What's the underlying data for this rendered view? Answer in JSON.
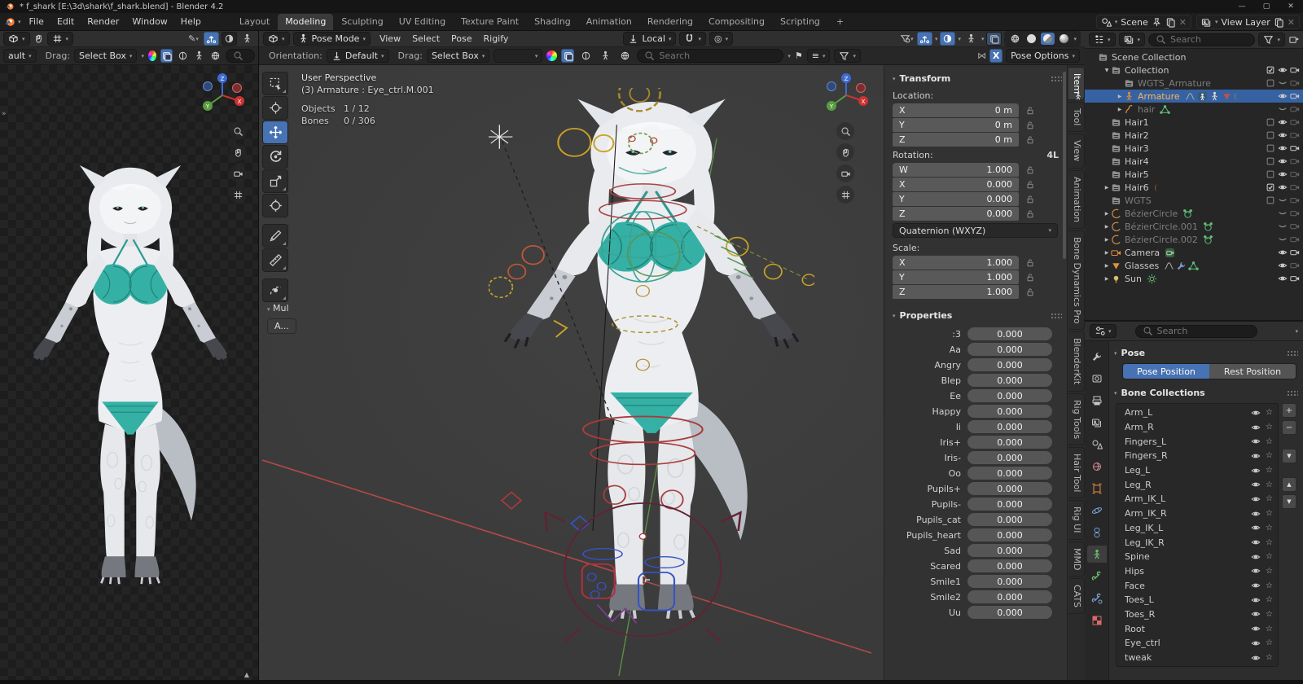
{
  "titlebar": {
    "title": "* f_shark [E:\\3d\\shark\\f_shark.blend] - Blender 4.2",
    "window_buttons": [
      "minimize",
      "maximize",
      "close"
    ]
  },
  "topbar": {
    "menus": [
      "File",
      "Edit",
      "Render",
      "Window",
      "Help"
    ],
    "tabs": [
      "Layout",
      "Modeling",
      "Sculpting",
      "UV Editing",
      "Texture Paint",
      "Shading",
      "Animation",
      "Rendering",
      "Compositing",
      "Scripting"
    ],
    "active_tab": "Modeling",
    "add_tab": "+",
    "scene": {
      "label": "Scene"
    },
    "view_layer": {
      "label": "View Layer"
    }
  },
  "vp_header": {
    "mode": "Pose Mode",
    "menus": [
      "View",
      "Select",
      "Pose",
      "Rigify"
    ],
    "orientation": "Local",
    "shading_modes": [
      "wireframe",
      "solid",
      "material-preview",
      "rendered"
    ],
    "active_shading": "material-preview"
  },
  "tool_settings": {
    "left": {
      "clipped_dropdown": "ault",
      "drag_label": "Drag:",
      "drag_value": "Select Box",
      "search_placeholder": "Searc"
    },
    "main": {
      "orientation_label": "Orientation:",
      "orientation_value": "Default",
      "drag_label": "Drag:",
      "drag_value": "Select Box",
      "search_placeholder": "Search",
      "mirror_x_label": "X",
      "pose_options_label": "Pose Options"
    }
  },
  "viewport": {
    "info_line1": "User Perspective",
    "info_line2": "(3) Armature : Eye_ctrl.M.001",
    "stats": [
      {
        "label": "Objects",
        "value": "1 / 12"
      },
      {
        "label": "Bones",
        "value": "0 / 306"
      }
    ],
    "collapsed_panel_label": "Mul",
    "collapsed_button_label": "A...",
    "toolbar": [
      "select-box-tool",
      "cursor-tool",
      "move-tool",
      "rotate-tool",
      "scale-tool",
      "transform-tool",
      "annotate-tool",
      "measure-tool",
      "pose-breakdowner-tool"
    ],
    "active_tool": "move-tool",
    "nav_buttons": [
      "zoom",
      "pan",
      "camera-view",
      "grid-ortho"
    ]
  },
  "npanel": {
    "transform_title": "Transform",
    "location_label": "Location:",
    "location": [
      {
        "axis": "X",
        "value": "0 m"
      },
      {
        "axis": "Y",
        "value": "0 m"
      },
      {
        "axis": "Z",
        "value": "0 m"
      }
    ],
    "rotation_label": "Rotation:",
    "rotation_badge": "4L",
    "rotation": [
      {
        "axis": "W",
        "value": "1.000"
      },
      {
        "axis": "X",
        "value": "0.000"
      },
      {
        "axis": "Y",
        "value": "0.000"
      },
      {
        "axis": "Z",
        "value": "0.000"
      }
    ],
    "rotation_mode": "Quaternion (WXYZ)",
    "scale_label": "Scale:",
    "scale": [
      {
        "axis": "X",
        "value": "1.000"
      },
      {
        "axis": "Y",
        "value": "1.000"
      },
      {
        "axis": "Z",
        "value": "1.000"
      }
    ],
    "properties_title": "Properties",
    "shape_keys": [
      {
        "name": ":3",
        "value": "0.000"
      },
      {
        "name": "Aa",
        "value": "0.000"
      },
      {
        "name": "Angry",
        "value": "0.000"
      },
      {
        "name": "Blep",
        "value": "0.000"
      },
      {
        "name": "Ee",
        "value": "0.000"
      },
      {
        "name": "Happy",
        "value": "0.000"
      },
      {
        "name": "Ii",
        "value": "0.000"
      },
      {
        "name": "Iris+",
        "value": "0.000"
      },
      {
        "name": "Iris-",
        "value": "0.000"
      },
      {
        "name": "Oo",
        "value": "0.000"
      },
      {
        "name": "Pupils+",
        "value": "0.000"
      },
      {
        "name": "Pupils-",
        "value": "0.000"
      },
      {
        "name": "Pupils_cat",
        "value": "0.000"
      },
      {
        "name": "Pupils_heart",
        "value": "0.000"
      },
      {
        "name": "Sad",
        "value": "0.000"
      },
      {
        "name": "Scared",
        "value": "0.000"
      },
      {
        "name": "Smile1",
        "value": "0.000"
      },
      {
        "name": "Smile2",
        "value": "0.000"
      },
      {
        "name": "Uu",
        "value": "0.000"
      }
    ]
  },
  "side_tabs": {
    "tabs": [
      "Item",
      "Tool",
      "View",
      "Animation",
      "Bone Dynamics Pro",
      "BlenderKit",
      "Rig Tools",
      "Hair Tool",
      "Rig UI",
      "MMD",
      "CATS"
    ],
    "active": "Item"
  },
  "outliner": {
    "search_placeholder": "Search",
    "rows": [
      {
        "label": "Scene Collection",
        "icon": "collection",
        "indent": 0,
        "right": []
      },
      {
        "label": "Collection",
        "icon": "collection",
        "indent": 1,
        "arrow": "v",
        "right": [
          "check",
          "eye",
          "cam"
        ]
      },
      {
        "label": "WGTS_Armature",
        "icon": "collection",
        "indent": 2,
        "muted": true,
        "right": [
          "box",
          "eyec",
          "camx"
        ]
      },
      {
        "label": "Armature",
        "icon": "armature",
        "indent": 2,
        "arrow": ">",
        "selected": true,
        "trail": [
          "anim",
          "badge",
          "fig",
          "cone",
          "cres"
        ],
        "right": [
          "sp",
          "eye",
          "cam"
        ]
      },
      {
        "label": "hair",
        "icon": "curves",
        "indent": 2,
        "arrow": ">",
        "muted": true,
        "trail": [
          "trig"
        ],
        "right": [
          "sp",
          "eyec",
          "camx"
        ]
      },
      {
        "label": "Hair1",
        "icon": "collection",
        "indent": 1,
        "right": [
          "box",
          "eye",
          "camx"
        ]
      },
      {
        "label": "Hair2",
        "icon": "collection",
        "indent": 1,
        "right": [
          "box",
          "eye",
          "camx"
        ]
      },
      {
        "label": "Hair3",
        "icon": "collection",
        "indent": 1,
        "right": [
          "box",
          "eye",
          "cam"
        ]
      },
      {
        "label": "Hair4",
        "icon": "collection",
        "indent": 1,
        "right": [
          "box",
          "eye",
          "camx"
        ]
      },
      {
        "label": "Hair5",
        "icon": "collection",
        "indent": 1,
        "right": [
          "box",
          "eye",
          "camx"
        ]
      },
      {
        "label": "Hair6",
        "icon": "collection",
        "indent": 1,
        "arrow": ">",
        "trail": [
          "cres"
        ],
        "right": [
          "check",
          "eye",
          "camx"
        ]
      },
      {
        "label": "WGTS",
        "icon": "collection",
        "indent": 1,
        "muted": true,
        "right": [
          "box",
          "eyec",
          "camx"
        ]
      },
      {
        "label": "BézierCircle",
        "icon": "curveobj",
        "indent": 1,
        "arrow": ">",
        "muted": true,
        "trail": [
          "curvec"
        ],
        "right": [
          "sp",
          "eyec",
          "camx"
        ]
      },
      {
        "label": "BézierCircle.001",
        "icon": "curveobj",
        "indent": 1,
        "arrow": ">",
        "muted": true,
        "trail": [
          "curvec"
        ],
        "right": [
          "sp",
          "eyec",
          "camx"
        ]
      },
      {
        "label": "BézierCircle.002",
        "icon": "curveobj",
        "indent": 1,
        "arrow": ">",
        "muted": true,
        "trail": [
          "curvec"
        ],
        "right": [
          "sp",
          "eyec",
          "camx"
        ]
      },
      {
        "label": "Camera",
        "icon": "camobj",
        "indent": 1,
        "arrow": ">",
        "trail": [
          "cambadge"
        ],
        "right": [
          "sp",
          "eye",
          "cam"
        ]
      },
      {
        "label": "Glasses",
        "icon": "meshdata",
        "indent": 1,
        "arrow": ">",
        "trail": [
          "anim",
          "wrench",
          "trig"
        ],
        "right": [
          "sp",
          "eye",
          "camx"
        ]
      },
      {
        "label": "Sun",
        "icon": "light",
        "indent": 1,
        "arrow": ">",
        "trail": [
          "sung"
        ],
        "right": [
          "sp",
          "eye",
          "cam"
        ]
      }
    ]
  },
  "properties": {
    "search_placeholder": "Search",
    "pose_title": "Pose",
    "pose_position_label": "Pose Position",
    "rest_position_label": "Rest Position",
    "bone_collections_title": "Bone Collections",
    "bone_collections": [
      "Arm_L",
      "Arm_R",
      "Fingers_L",
      "Fingers_R",
      "Leg_L",
      "Leg_R",
      "Arm_IK_L",
      "Arm_IK_R",
      "Leg_IK_L",
      "Leg_IK_R",
      "Spine",
      "Hips",
      "Face",
      "Toes_L",
      "Toes_R",
      "Root",
      "Eye_ctrl",
      "tweak"
    ],
    "list_buttons": [
      "add",
      "remove",
      "specials",
      "move-up",
      "move-down"
    ],
    "tabs": [
      "tool",
      "render",
      "output",
      "view-layer",
      "scene",
      "world",
      "object",
      "physics",
      "object-constraints",
      "object-data",
      "bone",
      "bone-constraint",
      "texture"
    ],
    "active_tab": "object-data"
  },
  "colors": {
    "accent_blue": "#4772b3",
    "selected_row": "#3662a2",
    "armature_name": "#ffb35c",
    "teal_bikini": "#35b0a5",
    "axis_red": "#b54848",
    "axis_green": "#5c8f46"
  }
}
